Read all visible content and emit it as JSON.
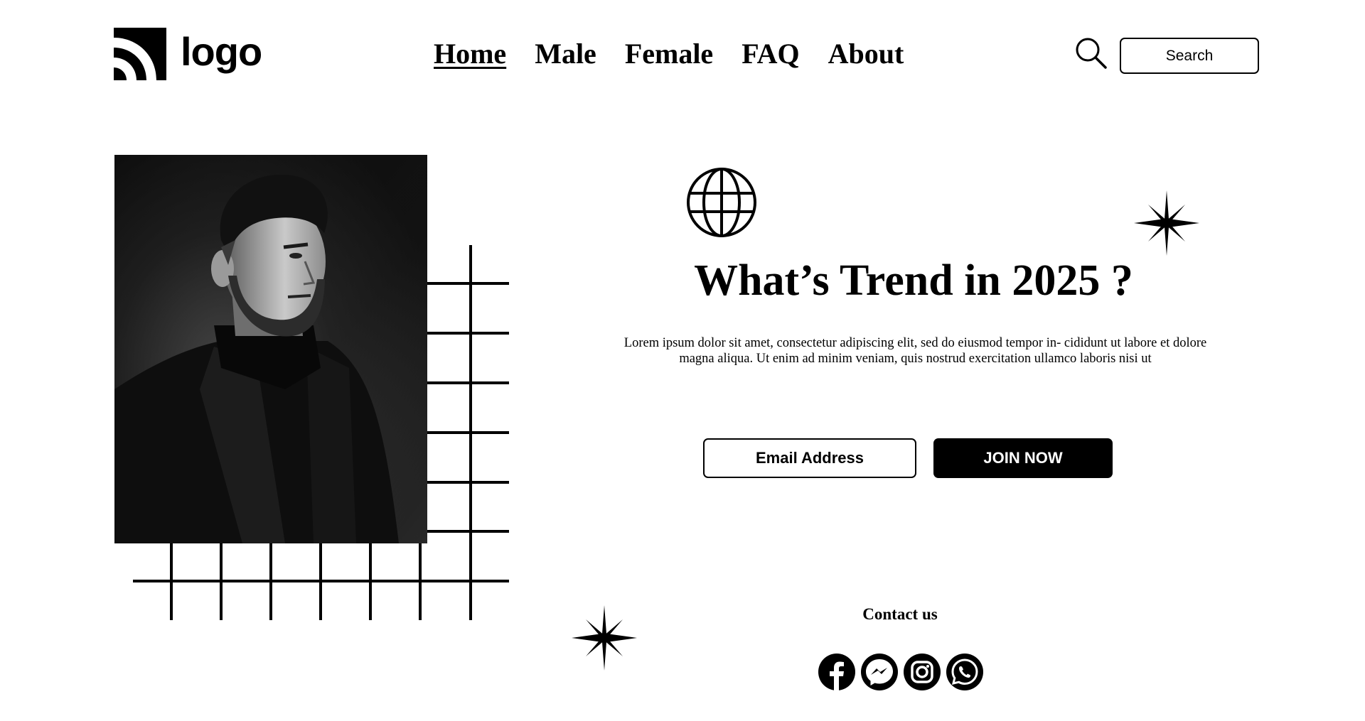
{
  "header": {
    "logo_text": "logo",
    "nav": [
      {
        "label": "Home",
        "active": true
      },
      {
        "label": "Male",
        "active": false
      },
      {
        "label": "Female",
        "active": false
      },
      {
        "label": "FAQ",
        "active": false
      },
      {
        "label": "About",
        "active": false
      }
    ],
    "search": {
      "placeholder": "Search",
      "icon": "search-icon"
    }
  },
  "hero": {
    "image_description_icon": "portrait-photo",
    "globe_icon": "globe-icon",
    "sparkle_icon": "sparkle-icon",
    "headline": "What’s Trend in 2025 ?",
    "subtext_line1": "Lorem ipsum dolor sit amet, consectetur adipiscing elit, sed do eiusmod tempor in- cididunt ut labore et dolore",
    "subtext_line2": "magna aliqua. Ut enim ad minim veniam, quis nostrud exercitation ullamco laboris nisi ut",
    "email_placeholder": "Email Address",
    "join_label": "JOIN NOW"
  },
  "contact": {
    "label": "Contact us",
    "social": [
      "facebook-icon",
      "messenger-icon",
      "instagram-icon",
      "whatsapp-icon"
    ]
  },
  "colors": {
    "text": "#000000",
    "background": "#ffffff",
    "button": "#000000",
    "button_text": "#ffffff"
  }
}
